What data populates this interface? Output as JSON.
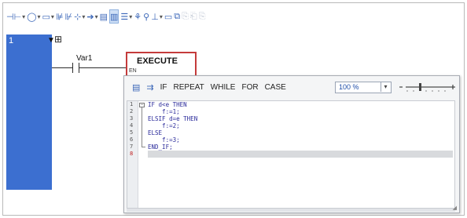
{
  "toolbar": {
    "items": [
      {
        "name": "contact-tool-icon",
        "glyph": "⊣⊢",
        "dd": true
      },
      {
        "name": "coil-tool-icon",
        "glyph": "◯",
        "dd": true
      },
      {
        "name": "block-tool-icon",
        "glyph": "▭",
        "dd": true
      },
      {
        "name": "parallel-branch-icon",
        "glyph": "⊯",
        "dd": false
      },
      {
        "name": "branch-icon",
        "glyph": "⊮",
        "dd": false
      },
      {
        "name": "insert-rung-icon",
        "glyph": "⊹",
        "dd": true
      },
      {
        "name": "jump-icon",
        "glyph": "➔",
        "dd": true
      },
      {
        "name": "network-view-icon",
        "glyph": "▤",
        "dd": false
      },
      {
        "name": "st-view-icon",
        "glyph": "▥",
        "dd": false,
        "selected": true
      },
      {
        "name": "list-view-icon",
        "glyph": "☰",
        "dd": true
      },
      {
        "name": "variables-icon",
        "glyph": "⚘",
        "dd": false
      },
      {
        "name": "person-icon",
        "glyph": "⚲",
        "dd": false
      },
      {
        "name": "align-icon",
        "glyph": "⊥",
        "dd": true
      },
      {
        "name": "comment-icon",
        "glyph": "▭",
        "dd": false
      },
      {
        "name": "copy-icon",
        "glyph": "⧉",
        "dd": false
      },
      {
        "name": "disabled-icon-1",
        "glyph": "⎘",
        "dd": false,
        "dim": true
      },
      {
        "name": "disabled-icon-2",
        "glyph": "⎗",
        "dd": false,
        "dim": true
      },
      {
        "name": "disabled-icon-3",
        "glyph": "⎘",
        "dd": false,
        "dim": true
      }
    ]
  },
  "rung": {
    "number": "1",
    "contact_label": "Var1",
    "block_title": "EXECUTE",
    "en_label": "EN"
  },
  "editor": {
    "keywords": [
      "IF",
      "REPEAT",
      "WHILE",
      "FOR",
      "CASE"
    ],
    "zoom": "100 %",
    "code": [
      "IF d<e THEN",
      "    f:=1;",
      "ELSIF d=e THEN",
      "    f:=2;",
      "ELSE",
      "    f:=3;",
      "END_IF;",
      ""
    ],
    "line_numbers": [
      "1",
      "2",
      "3",
      "4",
      "5",
      "6",
      "7",
      "8"
    ],
    "current_line_index": 7
  },
  "colors": {
    "rail": "#3c6fd0",
    "block_border": "#c43b3b",
    "code_text": "#2a2a9a"
  }
}
